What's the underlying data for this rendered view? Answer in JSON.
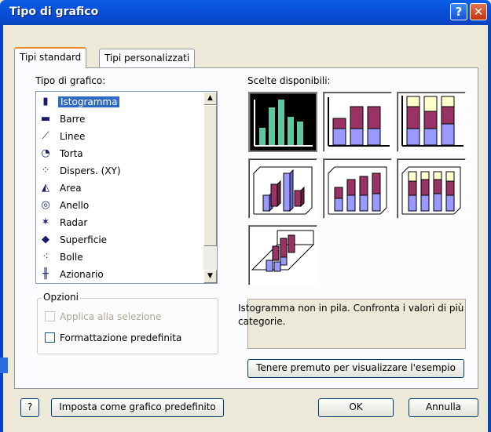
{
  "window": {
    "title": "Tipo di grafico",
    "help_glyph": "?",
    "close_glyph": "✕"
  },
  "tabs": [
    {
      "label": "Tipi standard",
      "active": true
    },
    {
      "label": "Tipi personalizzati",
      "active": false
    }
  ],
  "chart_type_list": {
    "label": "Tipo di grafico:",
    "items": [
      {
        "label": "Istogramma",
        "icon": "column-chart-icon",
        "selected": true
      },
      {
        "label": "Barre",
        "icon": "bar-chart-icon",
        "selected": false
      },
      {
        "label": "Linee",
        "icon": "line-chart-icon",
        "selected": false
      },
      {
        "label": "Torta",
        "icon": "pie-chart-icon",
        "selected": false
      },
      {
        "label": "Dispers. (XY)",
        "icon": "scatter-chart-icon",
        "selected": false
      },
      {
        "label": "Area",
        "icon": "area-chart-icon",
        "selected": false
      },
      {
        "label": "Anello",
        "icon": "doughnut-chart-icon",
        "selected": false
      },
      {
        "label": "Radar",
        "icon": "radar-chart-icon",
        "selected": false
      },
      {
        "label": "Superficie",
        "icon": "surface-chart-icon",
        "selected": false
      },
      {
        "label": "Bolle",
        "icon": "bubble-chart-icon",
        "selected": false
      },
      {
        "label": "Azionario",
        "icon": "stock-chart-icon",
        "selected": false
      }
    ]
  },
  "subtypes": {
    "label": "Scelte disponibili:",
    "selected_index": 0,
    "count": 7
  },
  "options": {
    "legend": "Opzioni",
    "apply_to_selection": {
      "label": "Applica alla selezione",
      "checked": false,
      "enabled": false
    },
    "default_formatting": {
      "label": "Formattazione predefinita",
      "checked": false,
      "enabled": true
    }
  },
  "description": "Istogramma non in pila. Confronta i valori di più categorie.",
  "buttons": {
    "preview": "Tenere premuto per visualizzare l'esempio",
    "set_default": "Imposta come grafico predefinito",
    "ok": "OK",
    "cancel": "Annulla",
    "help_glyph": "?"
  },
  "colors": {
    "title_bar": "#0a4fd8",
    "selection": "#316ac5",
    "bar_green": "#5fc8a0",
    "bar_maroon": "#993366",
    "bar_periwinkle": "#9999ff",
    "bar_cream": "#ffffcc"
  }
}
